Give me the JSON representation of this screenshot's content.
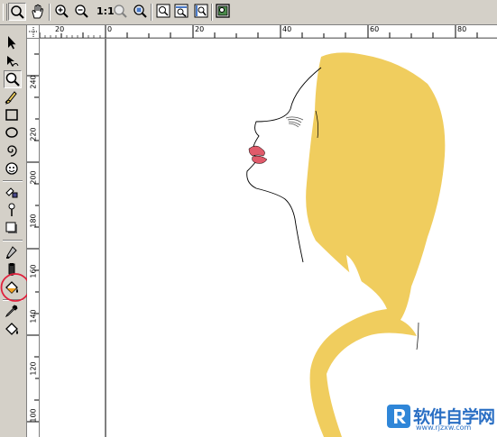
{
  "toolbar": {
    "zoom_ratio_label": "1:1",
    "buttons": [
      {
        "name": "zoom-tool",
        "icon": "magnifier-icon",
        "pressed": true
      },
      {
        "name": "pan-tool",
        "icon": "hand-icon"
      },
      {
        "name": "zoom-in",
        "icon": "zoom-in-icon"
      },
      {
        "name": "zoom-out",
        "icon": "zoom-out-icon"
      },
      {
        "name": "zoom-selected",
        "icon": "zoom-selected-icon"
      },
      {
        "name": "zoom-all-objects",
        "icon": "zoom-all-icon"
      },
      {
        "name": "zoom-page",
        "icon": "zoom-page-icon"
      },
      {
        "name": "zoom-page-width",
        "icon": "zoom-width-icon"
      },
      {
        "name": "zoom-page-height",
        "icon": "zoom-height-icon"
      }
    ]
  },
  "toolbox": {
    "tools": [
      {
        "name": "pick-tool",
        "icon": "arrow-pointer-icon"
      },
      {
        "name": "shape-tool",
        "icon": "shape-node-icon"
      },
      {
        "name": "zoom-tool",
        "icon": "magnifier-icon",
        "pressed": true
      },
      {
        "name": "freehand-tool",
        "icon": "pencil-icon"
      },
      {
        "name": "rectangle-tool",
        "icon": "rectangle-icon"
      },
      {
        "name": "ellipse-tool",
        "icon": "ellipse-icon"
      },
      {
        "name": "spiral-tool",
        "icon": "spiral-icon"
      },
      {
        "name": "basic-shapes-tool",
        "icon": "basic-shapes-icon"
      },
      {
        "name": "text-tool",
        "icon": "text-icon"
      },
      {
        "name": "interactive-blend-tool",
        "icon": "blend-icon"
      },
      {
        "name": "shadow-tool",
        "icon": "shadow-icon"
      },
      {
        "name": "outline-tool",
        "icon": "outline-pen-icon"
      },
      {
        "name": "fill-tool",
        "icon": "fill-bucket-icon"
      },
      {
        "name": "interactive-fill-tool",
        "icon": "paint-bucket-icon",
        "highlighted": true
      },
      {
        "name": "eyedropper-tool",
        "icon": "eyedropper-icon"
      },
      {
        "name": "paintbucket-tool",
        "icon": "paint-bucket-icon"
      }
    ]
  },
  "ruler_top": {
    "labels": [
      "20",
      "0",
      "20",
      "40",
      "60",
      "80",
      "100",
      "120",
      "140",
      "160"
    ]
  },
  "ruler_left": {
    "labels": [
      "240",
      "220",
      "200",
      "180",
      "160",
      "140",
      "120",
      "100"
    ]
  },
  "colors": {
    "hair": "#f0cd5e",
    "lips": "#e05a6a",
    "outline": "#000000",
    "highlight_circle": "#e0203c",
    "ui_face": "#d4d0c8"
  },
  "watermark": {
    "badge_letter": "R",
    "title": "软件自学网",
    "url": "www.rjzxw.com"
  }
}
